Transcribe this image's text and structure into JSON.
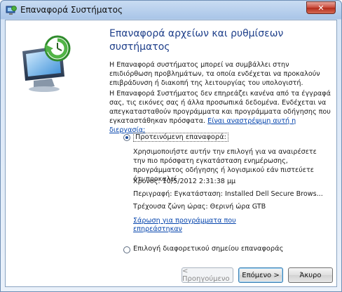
{
  "window": {
    "title": "Επαναφορά Συστήματος",
    "close_glyph": "✕"
  },
  "heading": "Επαναφορά αρχείων και ρυθμίσεων συστήματος",
  "intro_paragraph": "Η Επαναφορά συστήματος μπορεί να συμβάλλει στην επιδιόρθωση προβλημάτων, τα οποία ενδέχεται να προκαλούν επιβράδυνση ή διακοπή της λειτουργίας του υπολογιστή.",
  "info_paragraph": "Η Επαναφορά Συστήματος δεν επηρεάζει κανένα από τα έγγραφά σας, τις εικόνες σας ή άλλα προσωπικά δεδομένα. Ενδέχεται να απεγκατασταθούν προγράμματα και προγράμματα οδήγησης που εγκαταστάθηκαν πρόσφατα.",
  "reversible_link": "Είναι αναστρέψιμη αυτή η διεργασία;",
  "option_recommended": {
    "label": "Προτεινόμενη επαναφορά:",
    "selected": true,
    "description": "Χρησιμοποιήστε αυτήν την επιλογή για να αναιρέσετε την πιο πρόσφατη εγκατάσταση ενημέρωσης, προγράμματος οδήγησης ή λογισμικού εάν πιστεύετε ότι προκαλεί",
    "time": "Χρόνος: 10/5/2012 2:31:38 μμ",
    "description_line": "Περιγραφή: Εγκατάσταση: Installed Dell Secure Brows...",
    "timezone": "Τρέχουσα ζώνη ώρας: Θερινή ώρα GTB",
    "scan_link": "Σάρωση για προγράμματα που επηρεάστηκαν"
  },
  "option_other": {
    "label": "Επιλογή διαφορετικού σημείου επαναφοράς",
    "selected": false
  },
  "buttons": {
    "back": "< Προηγούμενο",
    "next": "Επόμενο >",
    "cancel": "Άκυρο"
  },
  "colors": {
    "heading": "#1e3f8a",
    "link": "#0645ad",
    "frame": "#a9c5e8"
  }
}
